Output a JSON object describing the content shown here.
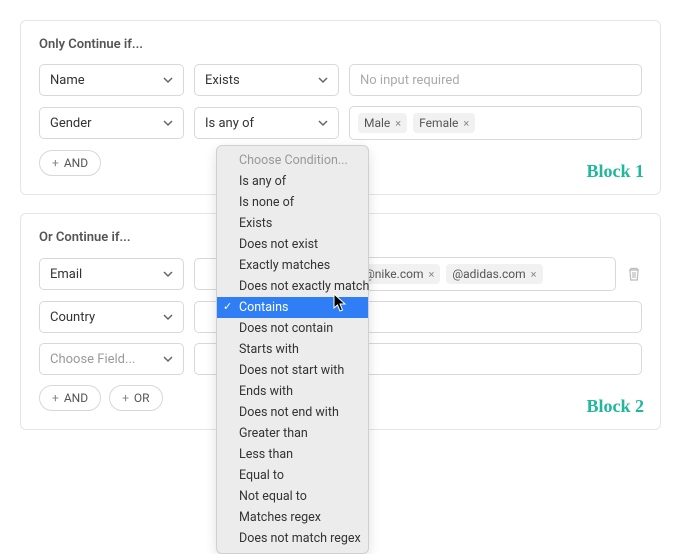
{
  "block1": {
    "title": "Only Continue if...",
    "annotation": "Block 1",
    "rows": [
      {
        "field": "Name",
        "condition": "Exists",
        "value_placeholder": "No input required"
      },
      {
        "field": "Gender",
        "condition": "Is any of",
        "tags": [
          "Male",
          "Female"
        ]
      }
    ],
    "buttons": {
      "and": "AND"
    }
  },
  "block2": {
    "title": "Or Continue if...",
    "annotation": "Block 2",
    "rows": [
      {
        "field": "Email",
        "condition": "",
        "tags": [
          "@nike.com",
          "@adidas.com"
        ],
        "trash": true
      },
      {
        "field": "Country",
        "condition": "",
        "tags": []
      },
      {
        "field_placeholder": "Choose Field...",
        "condition": "",
        "tags": []
      }
    ],
    "buttons": {
      "and": "AND",
      "or": "OR"
    }
  },
  "dropdown": {
    "header": "Choose Condition...",
    "items": [
      "Is any of",
      "Is none of",
      "Exists",
      "Does not exist",
      "Exactly matches",
      "Does not exactly match",
      "Contains",
      "Does not contain",
      "Starts with",
      "Does not start with",
      "Ends with",
      "Does not end with",
      "Greater than",
      "Less than",
      "Equal to",
      "Not equal to",
      "Matches regex",
      "Does not match regex"
    ],
    "selected": "Contains"
  },
  "icons": {
    "plus": "+",
    "x": "×"
  }
}
